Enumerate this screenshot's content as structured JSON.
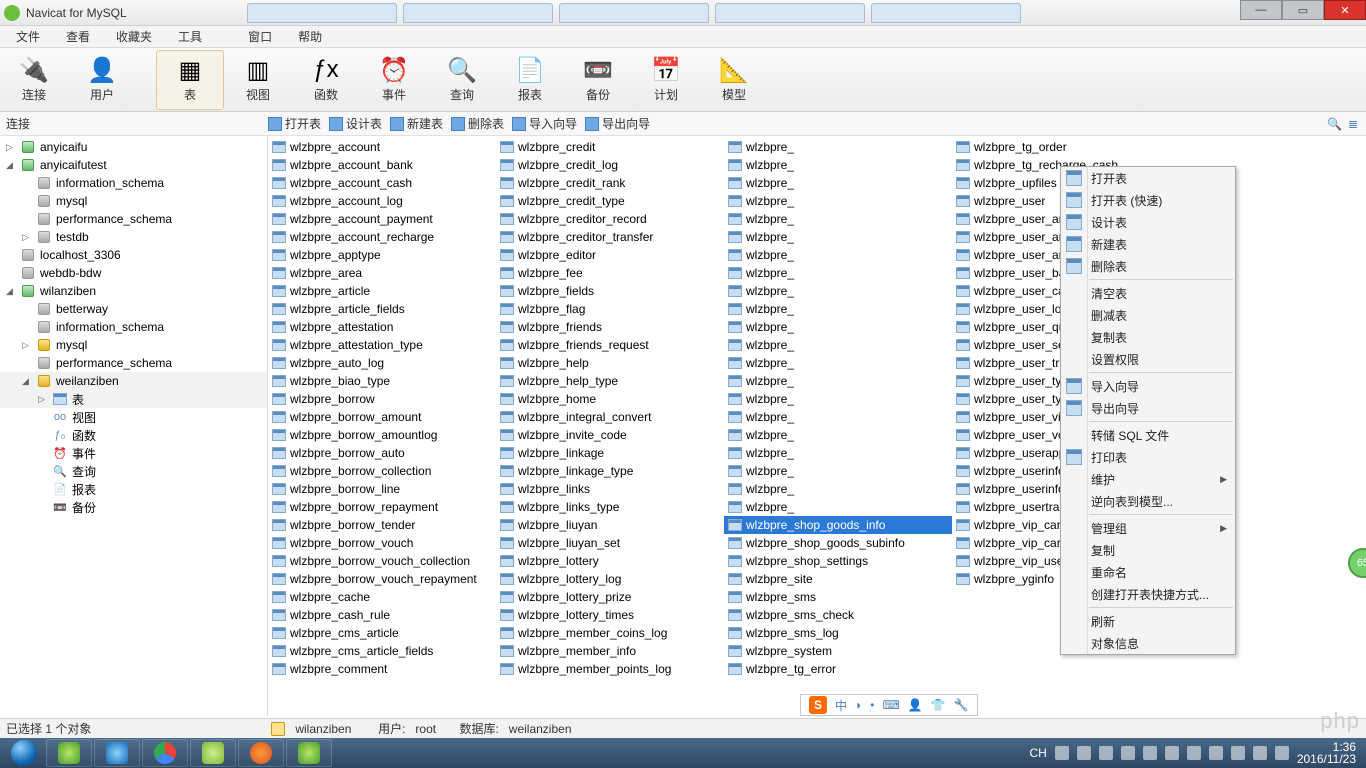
{
  "window": {
    "title": "Navicat for MySQL"
  },
  "menu": [
    "文件",
    "查看",
    "收藏夹",
    "工具",
    "窗口",
    "帮助"
  ],
  "toolbar": [
    {
      "label": "连接",
      "icon": "🔌"
    },
    {
      "label": "用户",
      "icon": "👤"
    },
    {
      "label": "表",
      "icon": "▦",
      "active": true
    },
    {
      "label": "视图",
      "icon": "▥"
    },
    {
      "label": "函数",
      "icon": "ƒx"
    },
    {
      "label": "事件",
      "icon": "⏰"
    },
    {
      "label": "查询",
      "icon": "🔍"
    },
    {
      "label": "报表",
      "icon": "📄"
    },
    {
      "label": "备份",
      "icon": "📼"
    },
    {
      "label": "计划",
      "icon": "📅"
    },
    {
      "label": "模型",
      "icon": "📐"
    }
  ],
  "sub_label": "连接",
  "sub_actions": [
    "打开表",
    "设计表",
    "新建表",
    "删除表",
    "导入向导",
    "导出向导"
  ],
  "tree": [
    {
      "t": "conn",
      "label": "anyicaifu",
      "open": false,
      "color": "green",
      "indent": 0,
      "arrow": "▷"
    },
    {
      "t": "conn",
      "label": "anyicaifutest",
      "open": true,
      "color": "green",
      "indent": 0,
      "arrow": "◢"
    },
    {
      "t": "db",
      "label": "information_schema",
      "color": "gray",
      "indent": 1
    },
    {
      "t": "db",
      "label": "mysql",
      "color": "gray",
      "indent": 1
    },
    {
      "t": "db",
      "label": "performance_schema",
      "color": "gray",
      "indent": 1
    },
    {
      "t": "db",
      "label": "testdb",
      "color": "gray",
      "indent": 1,
      "arrow": "▷"
    },
    {
      "t": "conn",
      "label": "localhost_3306",
      "color": "gray",
      "indent": 0
    },
    {
      "t": "conn",
      "label": "webdb-bdw",
      "color": "gray",
      "indent": 0
    },
    {
      "t": "conn",
      "label": "wilanziben",
      "open": true,
      "color": "green",
      "indent": 0,
      "arrow": "◢"
    },
    {
      "t": "db",
      "label": "betterway",
      "color": "gray",
      "indent": 1
    },
    {
      "t": "db",
      "label": "information_schema",
      "color": "gray",
      "indent": 1
    },
    {
      "t": "db",
      "label": "mysql",
      "color": "yellow",
      "indent": 1,
      "arrow": "▷"
    },
    {
      "t": "db",
      "label": "performance_schema",
      "color": "gray",
      "indent": 1
    },
    {
      "t": "db",
      "label": "weilanziben",
      "color": "yellow",
      "indent": 1,
      "arrow": "◢",
      "sel": true
    },
    {
      "t": "node",
      "label": "表",
      "icon": "tbl",
      "indent": 2,
      "arrow": "▷",
      "sel": true
    },
    {
      "t": "node",
      "label": "视图",
      "icon": "view",
      "indent": 2
    },
    {
      "t": "node",
      "label": "函数",
      "icon": "fn",
      "indent": 2
    },
    {
      "t": "node",
      "label": "事件",
      "icon": "ev",
      "indent": 2
    },
    {
      "t": "node",
      "label": "查询",
      "icon": "qr",
      "indent": 2
    },
    {
      "t": "node",
      "label": "报表",
      "icon": "rp",
      "indent": 2
    },
    {
      "t": "node",
      "label": "备份",
      "icon": "bk",
      "indent": 2
    }
  ],
  "columns": [
    [
      "wlzbpre_account",
      "wlzbpre_account_bank",
      "wlzbpre_account_cash",
      "wlzbpre_account_log",
      "wlzbpre_account_payment",
      "wlzbpre_account_recharge",
      "wlzbpre_apptype",
      "wlzbpre_area",
      "wlzbpre_article",
      "wlzbpre_article_fields",
      "wlzbpre_attestation",
      "wlzbpre_attestation_type",
      "wlzbpre_auto_log",
      "wlzbpre_biao_type",
      "wlzbpre_borrow",
      "wlzbpre_borrow_amount",
      "wlzbpre_borrow_amountlog",
      "wlzbpre_borrow_auto",
      "wlzbpre_borrow_collection",
      "wlzbpre_borrow_line",
      "wlzbpre_borrow_repayment",
      "wlzbpre_borrow_tender",
      "wlzbpre_borrow_vouch",
      "wlzbpre_borrow_vouch_collection",
      "wlzbpre_borrow_vouch_repayment",
      "wlzbpre_cache",
      "wlzbpre_cash_rule",
      "wlzbpre_cms_article",
      "wlzbpre_cms_article_fields",
      "wlzbpre_comment"
    ],
    [
      "wlzbpre_credit",
      "wlzbpre_credit_log",
      "wlzbpre_credit_rank",
      "wlzbpre_credit_type",
      "wlzbpre_creditor_record",
      "wlzbpre_creditor_transfer",
      "wlzbpre_editor",
      "wlzbpre_fee",
      "wlzbpre_fields",
      "wlzbpre_flag",
      "wlzbpre_friends",
      "wlzbpre_friends_request",
      "wlzbpre_help",
      "wlzbpre_help_type",
      "wlzbpre_home",
      "wlzbpre_integral_convert",
      "wlzbpre_invite_code",
      "wlzbpre_linkage",
      "wlzbpre_linkage_type",
      "wlzbpre_links",
      "wlzbpre_links_type",
      "wlzbpre_liuyan",
      "wlzbpre_liuyan_set",
      "wlzbpre_lottery",
      "wlzbpre_lottery_log",
      "wlzbpre_lottery_prize",
      "wlzbpre_lottery_times",
      "wlzbpre_member_coins_log",
      "wlzbpre_member_info",
      "wlzbpre_member_points_log"
    ],
    [
      "wlzbpre_",
      "wlzbpre_",
      "wlzbpre_",
      "wlzbpre_",
      "wlzbpre_",
      "wlzbpre_",
      "wlzbpre_",
      "wlzbpre_",
      "wlzbpre_",
      "wlzbpre_",
      "wlzbpre_",
      "wlzbpre_",
      "wlzbpre_",
      "wlzbpre_",
      "wlzbpre_",
      "wlzbpre_",
      "wlzbpre_",
      "wlzbpre_",
      "wlzbpre_",
      "wlzbpre_",
      "wlzbpre_",
      "wlzbpre_shop_goods_info",
      "wlzbpre_shop_goods_subinfo",
      "wlzbpre_shop_settings",
      "wlzbpre_site",
      "wlzbpre_sms",
      "wlzbpre_sms_check",
      "wlzbpre_sms_log",
      "wlzbpre_system",
      "wlzbpre_tg_error"
    ],
    [
      "wlzbpre_tg_order",
      "wlzbpre_tg_recharge_cash",
      "wlzbpre_upfiles",
      "wlzbpre_user",
      "wlzbpre_user_amount",
      "wlzbpre_user_amountapply",
      "wlzbpre_user_amountlog",
      "wlzbpre_user_backup",
      "wlzbpre_user_cache",
      "wlzbpre_user_log",
      "wlzbpre_user_quickborrow",
      "wlzbpre_user_sendemail_log",
      "wlzbpre_user_trend",
      "wlzbpre_user_type",
      "wlzbpre_user_typechange",
      "wlzbpre_user_visit",
      "wlzbpre_user_vouch",
      "wlzbpre_userapp",
      "wlzbpre_userinfo",
      "wlzbpre_userinfo_conf",
      "wlzbpre_usertrack",
      "wlzbpre_vip_card",
      "wlzbpre_vip_card_type",
      "wlzbpre_vip_user",
      "wlzbpre_yginfo"
    ]
  ],
  "selected_table": "wlzbpre_shop_goods_info",
  "context_menu": [
    {
      "label": "打开表",
      "icon": true
    },
    {
      "label": "打开表 (快速)",
      "icon": true
    },
    {
      "label": "设计表",
      "icon": true
    },
    {
      "label": "新建表",
      "icon": true
    },
    {
      "label": "删除表",
      "icon": true
    },
    {
      "sep": true
    },
    {
      "label": "清空表"
    },
    {
      "label": "删减表"
    },
    {
      "label": "复制表"
    },
    {
      "label": "设置权限"
    },
    {
      "sep": true
    },
    {
      "label": "导入向导",
      "icon": true
    },
    {
      "label": "导出向导",
      "icon": true
    },
    {
      "sep": true
    },
    {
      "label": "转储 SQL 文件"
    },
    {
      "label": "打印表",
      "icon": true
    },
    {
      "label": "维护",
      "sub": true
    },
    {
      "label": "逆向表到模型..."
    },
    {
      "sep": true
    },
    {
      "label": "管理组",
      "sub": true
    },
    {
      "label": "复制"
    },
    {
      "label": "重命名"
    },
    {
      "label": "创建打开表快捷方式..."
    },
    {
      "sep": true
    },
    {
      "label": "刷新"
    },
    {
      "label": "对象信息"
    }
  ],
  "status": {
    "selection": "已选择 1 个对象",
    "conn": "wilanziben",
    "user_lbl": "用户:",
    "user": "root",
    "db_lbl": "数据库:",
    "db": "weilanziben"
  },
  "ime": {
    "logo": "S",
    "items": [
      "中",
      "◗",
      "•ִ",
      "⌨",
      "👤",
      "👕",
      "🔧"
    ]
  },
  "tray": {
    "lang": "CH",
    "time": "1:36",
    "date": "2016/11/23"
  },
  "badge": "65",
  "watermark": "php"
}
